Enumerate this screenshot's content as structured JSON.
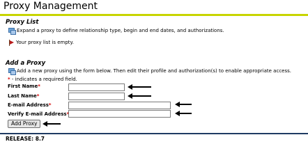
{
  "header": {
    "title": "Proxy Management"
  },
  "proxy_list": {
    "heading": "Proxy List",
    "info_text": "Expand a proxy to define relationship type, begin and end dates, and authorizations.",
    "empty_text": "Your proxy list is empty."
  },
  "add_proxy": {
    "heading": "Add a Proxy",
    "info_text": "Add a new proxy using the form below. Then edit their profile and authorization(s) to enable appropriate access.",
    "required_star": "*",
    "required_note": " - indicates a required field.",
    "fields": {
      "first_name": {
        "label": "First Name",
        "value": ""
      },
      "last_name": {
        "label": "Last Name",
        "value": ""
      },
      "email": {
        "label": "E-mail Address",
        "value": ""
      },
      "verify_email": {
        "label": "Verify E-mail Address",
        "value": ""
      }
    },
    "submit_label": "Add Proxy"
  },
  "footer": {
    "release": "RELEASE: 8.7"
  },
  "colors": {
    "title_underline": "#c7d400",
    "footer_bar": "#1f3b63",
    "required": "#d40000"
  },
  "icons": {
    "info": "info-stack-icon",
    "warning": "warning-flag-icon",
    "arrow": "arrow-left-icon"
  }
}
